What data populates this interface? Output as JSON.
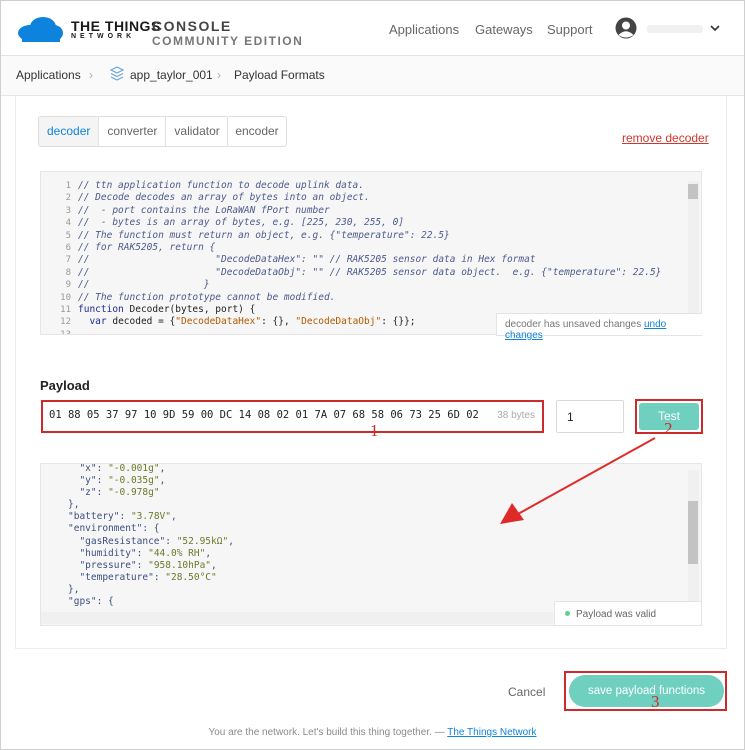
{
  "header": {
    "brand_main": "THE THINGS",
    "brand_sub": "NETWORK",
    "console_title": "CONSOLE",
    "console_edition": "COMMUNITY EDITION",
    "nav": [
      "Applications",
      "Gateways",
      "Support"
    ]
  },
  "breadcrumb": {
    "items": [
      "Applications",
      "app_taylor_001",
      "Payload Formats"
    ]
  },
  "tabs": {
    "items": [
      "decoder",
      "converter",
      "validator"
    ],
    "active": "decoder",
    "encoder": "encoder",
    "remove_link": "remove decoder"
  },
  "editor": {
    "line_numbers": [
      "1",
      "2",
      "3",
      "4",
      "5",
      "6",
      "7",
      "8",
      "9",
      "10",
      "11",
      "12",
      "13"
    ],
    "unsaved_text": "decoder has unsaved changes",
    "undo_link": "undo changes"
  },
  "payload": {
    "title": "Payload",
    "value": "01 88 05 37 97 10 9D 59 00 DC 14 08 02 01 7A 07 68 58 06 73 25 6D 02",
    "bytes_label": "38 bytes",
    "port_value": "1",
    "test_label": "Test"
  },
  "output": {
    "valid_text": "Payload was valid"
  },
  "actions": {
    "cancel_label": "Cancel",
    "save_label": "save payload functions"
  },
  "footer": {
    "text": "You are the network. Let's build this thing together. — ",
    "link": "The Things Network"
  },
  "annotations": [
    "1",
    "2",
    "3"
  ],
  "colors": {
    "accent": "#0d83dd",
    "teal": "#6fd0c0",
    "annotation_red": "#cc2b2b"
  }
}
